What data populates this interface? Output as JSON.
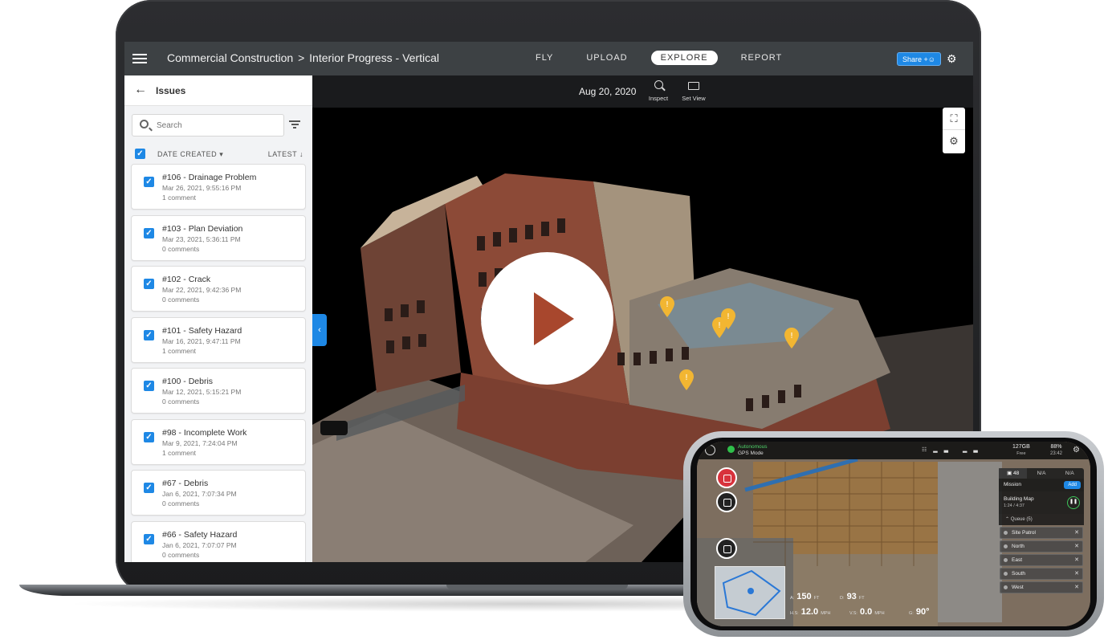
{
  "header": {
    "breadcrumb_project": "Commercial Construction",
    "breadcrumb_sep": ">",
    "breadcrumb_page": "Interior Progress - Vertical",
    "tabs": [
      {
        "label": "FLY",
        "active": false
      },
      {
        "label": "UPLOAD",
        "active": false
      },
      {
        "label": "EXPLORE",
        "active": true
      },
      {
        "label": "REPORT",
        "active": false
      }
    ],
    "share_label": "Share",
    "accent_color": "#1e88e5"
  },
  "sidebar": {
    "title": "Issues",
    "search_placeholder": "Search",
    "sort_label": "DATE CREATED",
    "order_label": "LATEST",
    "issues": [
      {
        "title": "#106 - Drainage Problem",
        "date": "Mar 26, 2021, 9:55:16 PM",
        "comments": "1 comment"
      },
      {
        "title": "#103 - Plan Deviation",
        "date": "Mar 23, 2021, 5:36:11 PM",
        "comments": "0 comments"
      },
      {
        "title": "#102 - Crack",
        "date": "Mar 22, 2021, 9:42:36 PM",
        "comments": "0 comments"
      },
      {
        "title": "#101 - Safety Hazard",
        "date": "Mar 16, 2021, 9:47:11 PM",
        "comments": "1 comment"
      },
      {
        "title": "#100 - Debris",
        "date": "Mar 12, 2021, 5:15:21 PM",
        "comments": "0 comments"
      },
      {
        "title": "#98 - Incomplete Work",
        "date": "Mar 9, 2021, 7:24:04 PM",
        "comments": "1 comment"
      },
      {
        "title": "#67 - Debris",
        "date": "Jan 6, 2021, 7:07:34 PM",
        "comments": "0 comments"
      },
      {
        "title": "#66 - Safety Hazard",
        "date": "Jan 6, 2021, 7:07:07 PM",
        "comments": "0 comments"
      }
    ]
  },
  "viewer": {
    "date": "Aug 20, 2020",
    "inspect_label": "Inspect",
    "set_view_label": "Set View"
  },
  "phone": {
    "mode": "Autonomous",
    "mode_sub": "GPS Mode",
    "storage": "127GB",
    "storage_sub": "Free",
    "battery": "88%",
    "battery_time": "23:42",
    "photo_count": "48",
    "tab_na_1": "N/A",
    "tab_na_2": "N/A",
    "mission_label": "Mission",
    "add_label": "Add",
    "map_title": "Building Map",
    "map_time": "1:24 / 4:37",
    "queue_label": "Queue (5)",
    "queue": [
      "Site Patrol",
      "North",
      "East",
      "South",
      "West"
    ],
    "altitude": "150",
    "altitude_unit": "FT",
    "distance": "93",
    "distance_unit": "FT",
    "hspeed": "12.0",
    "hspeed_unit": "MPH",
    "vspeed": "0.0",
    "vspeed_unit": "MPH",
    "gimbal": "90°",
    "alt_prefix": "A:",
    "dist_prefix": "D:",
    "hs_prefix": "H.S:",
    "vs_prefix": "V.S:",
    "g_prefix": "G:"
  }
}
